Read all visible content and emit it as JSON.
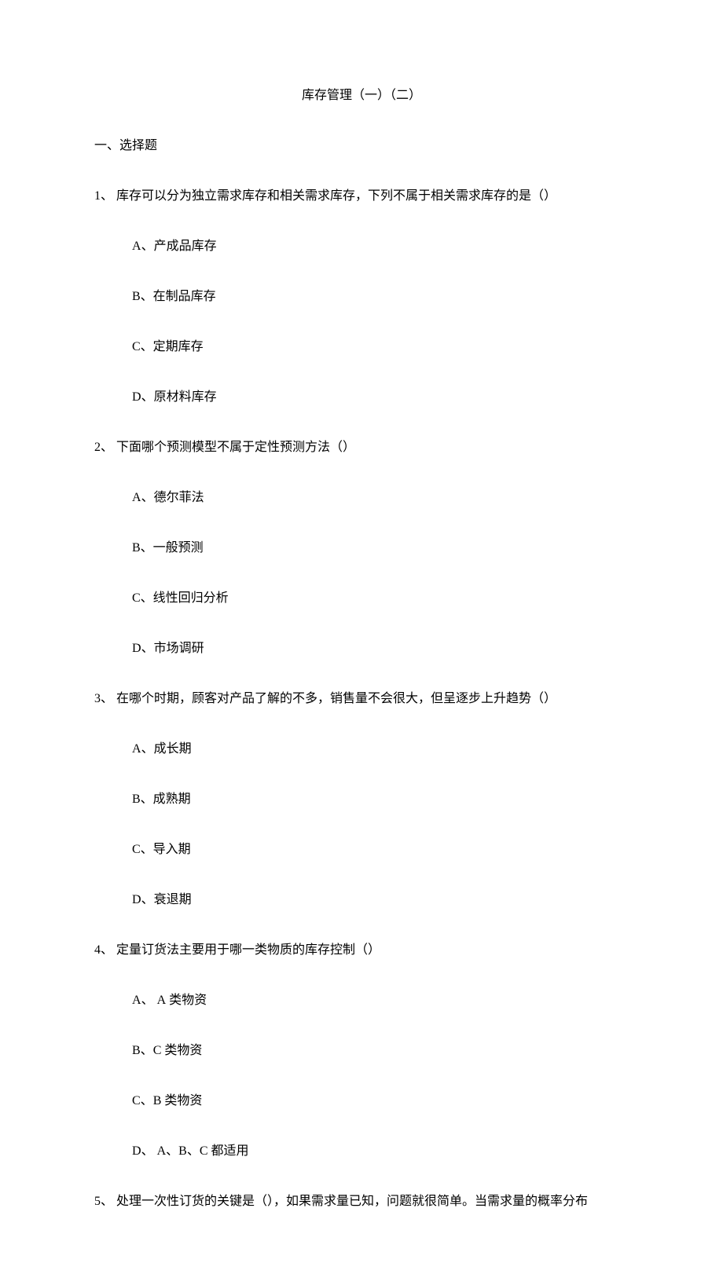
{
  "title": "库存管理（一）（二）",
  "section_heading": "一、选择题",
  "questions": [
    {
      "text": "1、 库存可以分为独立需求库存和相关需求库存，下列不属于相关需求库存的是（）",
      "options": [
        "A、产成品库存",
        "B、在制品库存",
        "C、定期库存",
        "D、原材料库存"
      ]
    },
    {
      "text": "2、 下面哪个预测模型不属于定性预测方法（）",
      "options": [
        "A、德尔菲法",
        "B、一般预测",
        "C、线性回归分析",
        "D、市场调研"
      ]
    },
    {
      "text": "3、 在哪个时期，顾客对产品了解的不多，销售量不会很大，但呈逐步上升趋势（）",
      "options": [
        "A、成长期",
        "B、成熟期",
        "C、导入期",
        "D、衰退期"
      ]
    },
    {
      "text": "4、 定量订货法主要用于哪一类物质的库存控制（）",
      "options": [
        "A、 A 类物资",
        "B、C 类物资",
        "C、B 类物资",
        "D、 A、B、C 都适用"
      ]
    },
    {
      "text": "5、 处理一次性订货的关键是（），如果需求量已知，问题就很简单。当需求量的概率分布",
      "options": []
    }
  ]
}
